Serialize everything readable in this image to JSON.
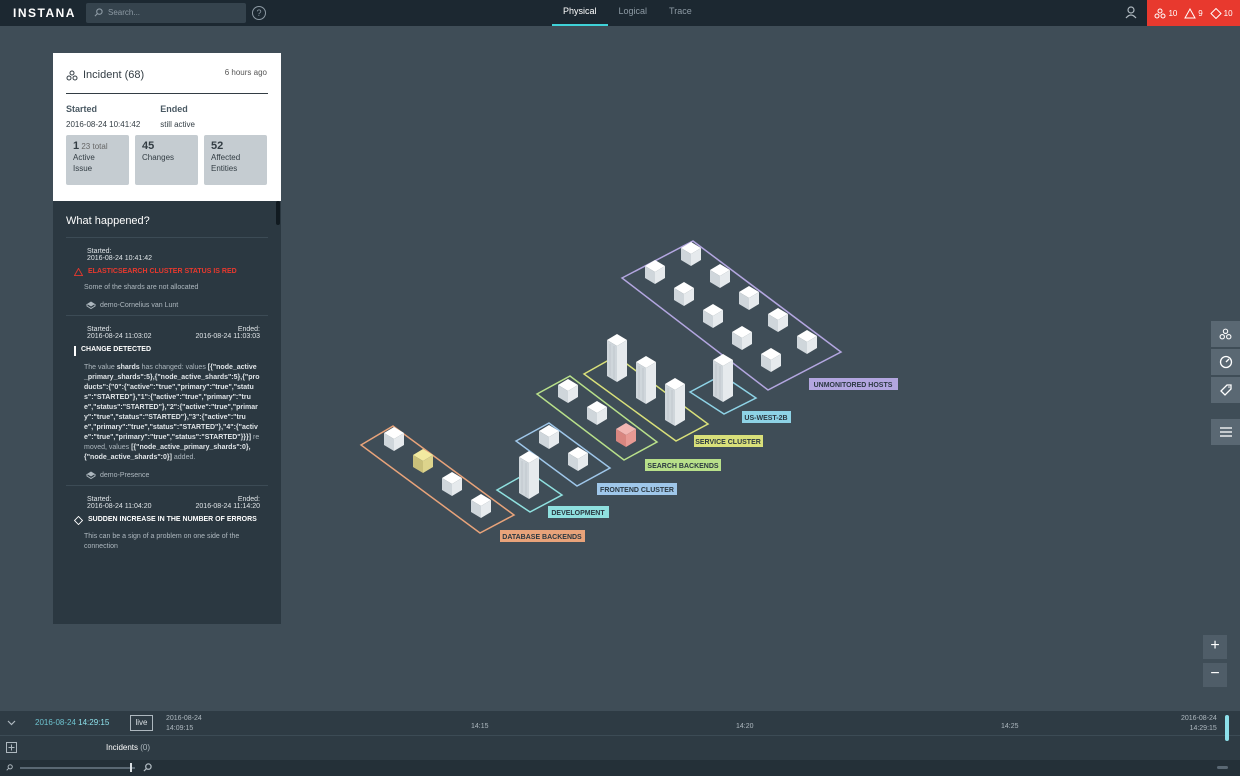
{
  "header": {
    "logo": "INSTANA",
    "search_placeholder": "Search...",
    "help": "?",
    "tabs": [
      "Physical",
      "Logical",
      "Trace"
    ],
    "alerts": {
      "incidents": "10",
      "issues": "9",
      "changes": "10"
    }
  },
  "incident": {
    "title": "Incident (68)",
    "ago": "6 hours ago",
    "started_label": "Started",
    "started_value": "2016-08-24 10:41:42",
    "ended_label": "Ended",
    "ended_value": "still active",
    "boxes": [
      {
        "num": "1",
        "extra": "23 total",
        "label1": "Active",
        "label2": "Issue"
      },
      {
        "num": "45",
        "extra": "",
        "label1": "Changes",
        "label2": ""
      },
      {
        "num": "52",
        "extra": "",
        "label1": "Affected",
        "label2": "Entities"
      }
    ]
  },
  "what_happened": {
    "heading": "What happened?",
    "events": [
      {
        "started_label": "Started:",
        "started": "2016-08-24 10:41:42",
        "ended_label": "",
        "ended": "",
        "title": "ELASTICSEARCH CLUSTER STATUS IS RED",
        "desc": "Some of the shards are not allocated",
        "host": "demo-Cornelius van Lunt"
      },
      {
        "started_label": "Started:",
        "started": "2016-08-24 11:03:02",
        "ended_label": "Ended:",
        "ended": "2016-08-24 11:03:03",
        "title": "CHANGE DETECTED",
        "desc_prefix": "The value ",
        "desc_key": "shards",
        "desc_mid": " has changed: values",
        "code1": "[{\"node_active_primary_shards\":5},{\"node_active_shards\":5},{\"products\":{\"0\":{\"active\":\"true\",\"primary\":\"true\",\"status\":\"STARTED\"},\"1\":{\"active\":\"true\",\"primary\":\"true\",\"status\":\"STARTED\"},\"2\":{\"active\":\"true\",\"primary\":\"true\",\"status\":\"STARTED\"},\"3\":{\"active\":\"true\",\"primary\":\"true\",\"status\":\"STARTED\"},\"4\":{\"active\":\"true\",\"primary\":\"true\",\"status\":\"STARTED\"}}}]",
        "removed": " removed, values",
        "code2": "[{\"node_active_primary_shards\":0},{\"node_active_shards\":0}]",
        "added": " added.",
        "host": "demo-Presence"
      },
      {
        "started_label": "Started:",
        "started": "2016-08-24 11:04:20",
        "ended_label": "Ended:",
        "ended": "2016-08-24 11:14:20",
        "title": "SUDDEN INCREASE IN THE NUMBER OF ERRORS",
        "desc": "This can be a sign of a problem on one side of the connection"
      }
    ]
  },
  "zones": {
    "unmonitored": "UNMONITORED HOSTS",
    "uswest": "US-WEST-2B",
    "service": "SERVICE CLUSTER",
    "search": "SEARCH BACKENDS",
    "frontend": "FRONTEND CLUSTER",
    "development": "DEVELOPMENT",
    "database": "DATABASE BACKENDS"
  },
  "colors": {
    "unmonitored": "#b3a6e0",
    "uswest": "#8ed3e6",
    "service": "#d9e07a",
    "search": "#b8e08a",
    "frontend": "#9fc7ea",
    "development": "#8fe0df",
    "database": "#e8a37a"
  },
  "timeline": {
    "current_date": "2016-08-24",
    "current_time": "14:29:15",
    "live": "live",
    "start_date": "2016-08-24",
    "start_time": "14:09:15",
    "ticks": [
      "14:15",
      "14:20",
      "14:25"
    ],
    "end_date": "2016-08-24",
    "end_time": "14:29:15",
    "incidents_label": "Incidents",
    "incidents_count": "(0)"
  }
}
